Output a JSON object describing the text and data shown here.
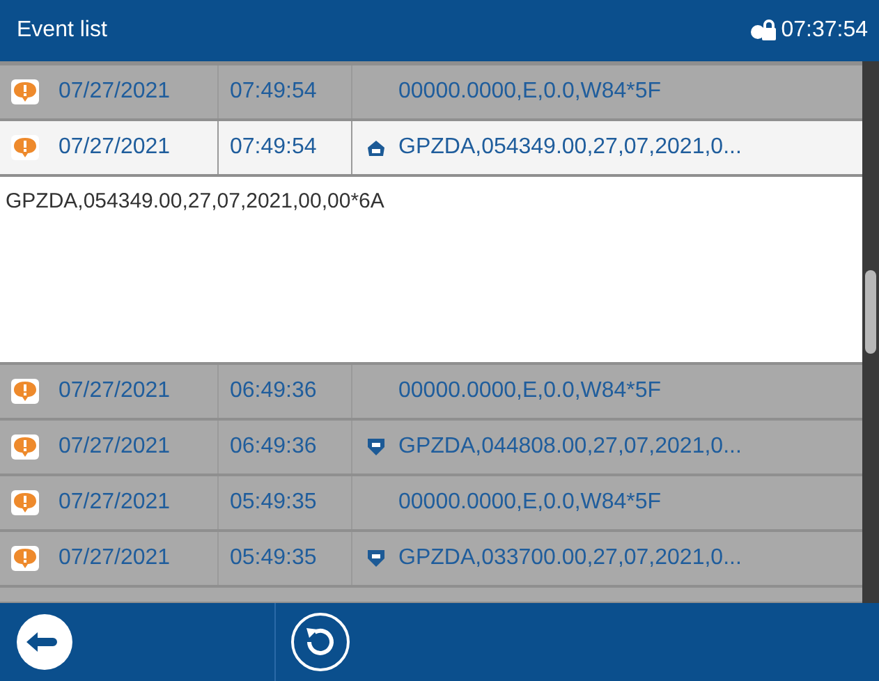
{
  "header": {
    "title": "Event list",
    "clock": "07:37:54"
  },
  "rows": [
    {
      "date": "07/27/2021",
      "time": "07:49:54",
      "kind": "none",
      "message": "00000.0000,E,0.0,W84*5F",
      "selected": false,
      "expanded": false
    },
    {
      "date": "07/27/2021",
      "time": "07:49:54",
      "kind": "up",
      "message": "GPZDA,054349.00,27,07,2021,0...",
      "selected": true,
      "expanded": true,
      "detail": "GPZDA,054349.00,27,07,2021,00,00*6A"
    },
    {
      "date": "07/27/2021",
      "time": "06:49:36",
      "kind": "none",
      "message": "00000.0000,E,0.0,W84*5F",
      "selected": false,
      "expanded": false
    },
    {
      "date": "07/27/2021",
      "time": "06:49:36",
      "kind": "down",
      "message": "GPZDA,044808.00,27,07,2021,0...",
      "selected": false,
      "expanded": false
    },
    {
      "date": "07/27/2021",
      "time": "05:49:35",
      "kind": "none",
      "message": "00000.0000,E,0.0,W84*5F",
      "selected": false,
      "expanded": false
    },
    {
      "date": "07/27/2021",
      "time": "05:49:35",
      "kind": "down",
      "message": "GPZDA,033700.00,27,07,2021,0...",
      "selected": false,
      "expanded": false
    }
  ]
}
